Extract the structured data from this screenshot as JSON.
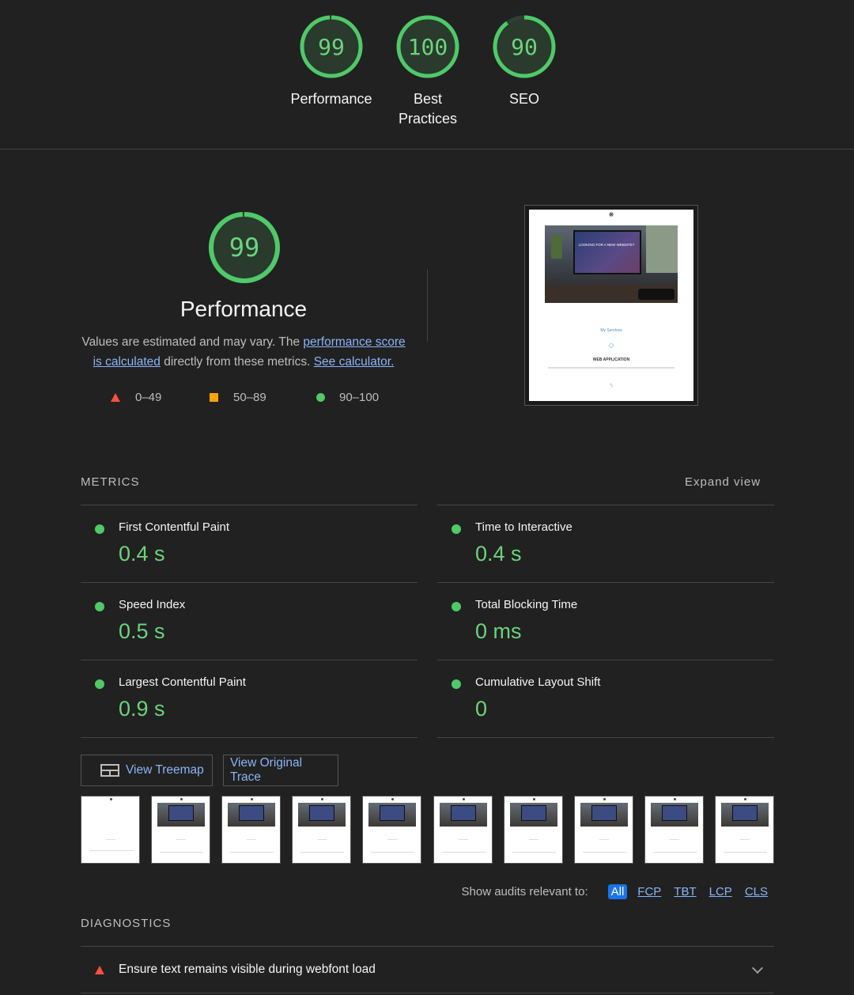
{
  "gauges": [
    {
      "score": "99",
      "label": "Performance",
      "fraction": 0.99
    },
    {
      "score": "100",
      "label": "Best Practices",
      "fraction": 1.0
    },
    {
      "score": "90",
      "label": "SEO",
      "fraction": 0.9
    }
  ],
  "performance": {
    "score": "99",
    "fraction": 0.99,
    "title": "Performance",
    "desc_prefix": "Values are estimated and may vary. The ",
    "link_score": "performance score is calculated",
    "desc_middle": " directly from these metrics. ",
    "link_calc": "See calculator."
  },
  "legend": {
    "poor": "0–49",
    "average": "50–89",
    "good": "90–100"
  },
  "screenshot": {
    "hero_text": "LOOKING FOR A NEW WEBSITE?",
    "services": "My Services",
    "service_name": "WEB APPLICATION"
  },
  "metrics": {
    "title": "METRICS",
    "expand": "Expand view",
    "items": [
      {
        "label": "First Contentful Paint",
        "value": "0.4 s"
      },
      {
        "label": "Time to Interactive",
        "value": "0.4 s"
      },
      {
        "label": "Speed Index",
        "value": "0.5 s"
      },
      {
        "label": "Total Blocking Time",
        "value": "0 ms"
      },
      {
        "label": "Largest Contentful Paint",
        "value": "0.9 s"
      },
      {
        "label": "Cumulative Layout Shift",
        "value": "0"
      }
    ]
  },
  "buttons": {
    "treemap": "View Treemap",
    "trace": "View Original Trace"
  },
  "filter": {
    "label": "Show audits relevant to:",
    "chips": [
      "All",
      "FCP",
      "TBT",
      "LCP",
      "CLS"
    ]
  },
  "diagnostics": {
    "title": "DIAGNOSTICS",
    "items": [
      {
        "label": "Ensure text remains visible during webfont load"
      }
    ]
  },
  "colors": {
    "good": "#4fc969",
    "average": "#ffa400",
    "poor": "#ff4e42",
    "link": "#8ab4f8"
  }
}
